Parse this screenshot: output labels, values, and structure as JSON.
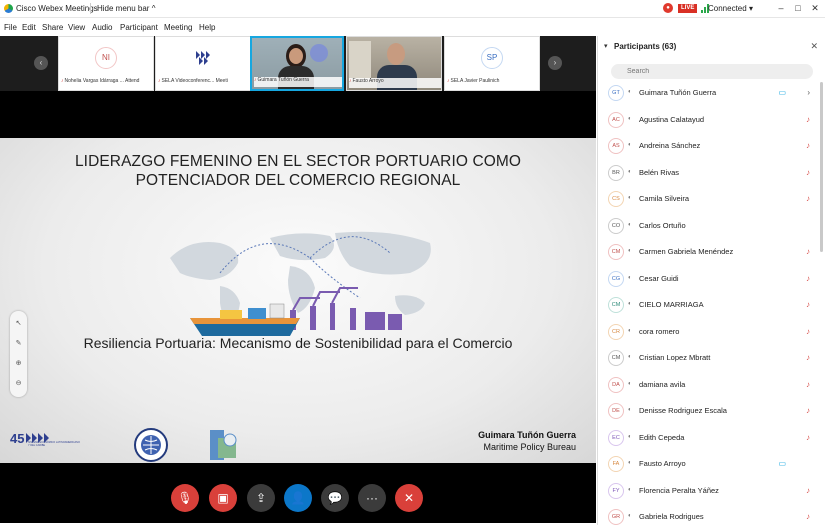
{
  "titlebar": {
    "app_name": "Cisco Webex Meetings",
    "hide_menu": "Hide menu bar ^",
    "live": "LIVE",
    "status": "Connected",
    "status_arrow": "▾",
    "minimize": "–",
    "maximize": "□",
    "close": "✕"
  },
  "menu": [
    "File",
    "Edit",
    "Share",
    "View",
    "Audio",
    "Participant",
    "Meeting",
    "Help"
  ],
  "strip": {
    "prev": "‹",
    "next": "›",
    "tiles": [
      {
        "initials": "NI",
        "label": "Nohelia Vargas Idárraga ... Attend"
      },
      {
        "initials": "",
        "label": "SELA Videoconferenc... Meeti"
      },
      {
        "initials": "",
        "label": "Guimara Tuñón Guerra"
      },
      {
        "initials": "",
        "label": "Fausto Arroyo"
      },
      {
        "initials": "SP",
        "label": "SELA Javier Paulinich"
      }
    ]
  },
  "slide": {
    "title": "LIDERAZGO FEMENINO EN EL SECTOR PORTUARIO COMO POTENCIADOR DEL COMERCIO REGIONAL",
    "subtitle": "Resiliencia Portuaria: Mecanismo de Sostenibilidad para el Comercio",
    "presenter_name": "Guimara Tuñón Guerra",
    "presenter_org": "Maritime Policy Bureau",
    "logo1": "45",
    "logo1_text": "SISTEMA ECONÓMICO LATINOAMERICANO Y DEL CARIBE"
  },
  "panel": {
    "title": "Participants (63)",
    "search_placeholder": "Search",
    "participants": [
      {
        "initials": "GT",
        "name": "Guimara Tuñón Guerra",
        "color": "blue",
        "cam": true,
        "muted": false
      },
      {
        "initials": "AC",
        "name": "Agustina Calatayud",
        "color": "red",
        "cam": false,
        "muted": true
      },
      {
        "initials": "AS",
        "name": "Andreina Sánchez",
        "color": "red",
        "cam": false,
        "muted": true
      },
      {
        "initials": "BR",
        "name": "Belén Rivas",
        "color": "gray",
        "cam": false,
        "muted": true
      },
      {
        "initials": "CS",
        "name": "Camila Silveira",
        "color": "orange",
        "cam": false,
        "muted": true
      },
      {
        "initials": "CO",
        "name": "Carlos Ortuño",
        "color": "gray",
        "cam": false,
        "muted": false
      },
      {
        "initials": "CM",
        "name": "Carmen Gabriela Menéndez",
        "color": "red",
        "cam": false,
        "muted": true
      },
      {
        "initials": "CG",
        "name": "Cesar Guidi",
        "color": "blue",
        "cam": false,
        "muted": true
      },
      {
        "initials": "CM",
        "name": "CIELO MARRIAGA",
        "color": "teal",
        "cam": false,
        "muted": true
      },
      {
        "initials": "CR",
        "name": "cora romero",
        "color": "orange",
        "cam": false,
        "muted": true
      },
      {
        "initials": "CM",
        "name": "Cristian Lopez Mbratt",
        "color": "gray",
        "cam": false,
        "muted": true
      },
      {
        "initials": "DA",
        "name": "damiana avila",
        "color": "red",
        "cam": false,
        "muted": true
      },
      {
        "initials": "DE",
        "name": "Denisse Rodriguez Escala",
        "color": "red",
        "cam": false,
        "muted": true
      },
      {
        "initials": "EC",
        "name": "Edith Cepeda",
        "color": "purple",
        "cam": false,
        "muted": true
      },
      {
        "initials": "FA",
        "name": "Fausto Arroyo",
        "color": "orange",
        "cam": true,
        "muted": false
      },
      {
        "initials": "FY",
        "name": "Florencia Peralta Yáñez",
        "color": "purple",
        "cam": false,
        "muted": true
      },
      {
        "initials": "GR",
        "name": "Gabriela Rodrigues",
        "color": "red",
        "cam": false,
        "muted": true
      }
    ]
  },
  "controls": {
    "mute": "🎙",
    "video": "▣",
    "share": "⇪",
    "participants": "👤",
    "chat": "💬",
    "more": "···",
    "leave": "✕"
  }
}
